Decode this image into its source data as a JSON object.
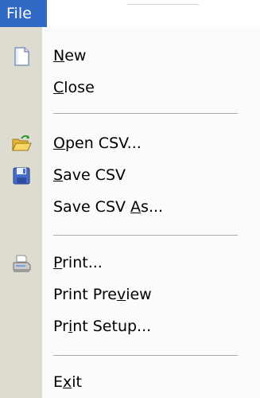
{
  "menubar": {
    "title": "File"
  },
  "menu": {
    "items": [
      {
        "text": "New",
        "mnemonic_index": 0,
        "icon": "new-document-icon"
      },
      {
        "text": "Close",
        "mnemonic_index": 0,
        "icon": null
      },
      {
        "separator": true
      },
      {
        "text": "Open CSV...",
        "mnemonic_index": 0,
        "icon": "open-folder-icon"
      },
      {
        "text": "Save CSV",
        "mnemonic_index": 0,
        "icon": "floppy-disk-icon"
      },
      {
        "text": "Save CSV As...",
        "mnemonic_index": 9,
        "icon": null
      },
      {
        "separator": true
      },
      {
        "text": "Print...",
        "mnemonic_index": 0,
        "icon": "printer-icon"
      },
      {
        "text": "Print Preview",
        "mnemonic_index": 9,
        "icon": null
      },
      {
        "text": "Print Setup...",
        "mnemonic_index": 2,
        "icon": null
      },
      {
        "separator": true
      },
      {
        "text": "Exit",
        "mnemonic_index": 1,
        "icon": null
      }
    ]
  },
  "colors": {
    "highlight": "#316ac5",
    "gutter": "#dedbd0",
    "menu_bg": "#fbfbfb"
  }
}
